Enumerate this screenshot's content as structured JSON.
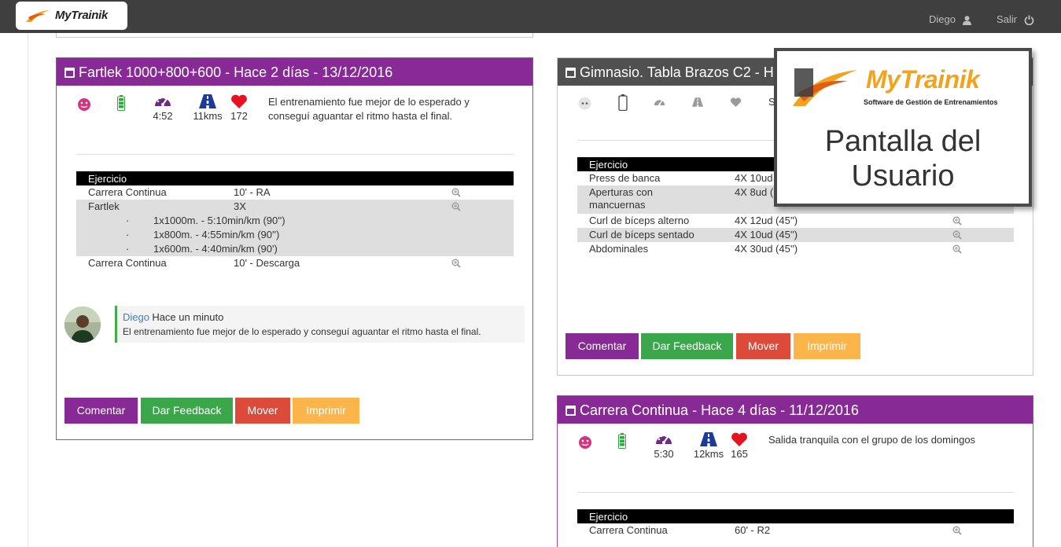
{
  "app": {
    "brand": "MyTrainik"
  },
  "topbar": {
    "user": "Diego",
    "logout": "Salir"
  },
  "promo": {
    "brand": "MyTrainik",
    "tagline": "Software de Gestión de Entrenamientos",
    "title_line1": "Pantalla del",
    "title_line2": "Usuario"
  },
  "colors": {
    "purple": "#872a95",
    "green": "#3aa84a",
    "red": "#dc4a3a",
    "orange": "#fbb54a",
    "header_dark": "#505050"
  },
  "cards": [
    {
      "title": "Fartlek 1000+800+600 - Hace 2 días - 13/12/2016",
      "stats": {
        "pace": "4:52",
        "distance": "11kms",
        "heart": "172"
      },
      "note": "El entrenamiento fue mejor de lo esperado y conseguí aguantar el ritmo hasta el final.",
      "table_header": "Ejercicio",
      "rows": [
        {
          "name": "Carrera Continua",
          "detail": "10' - RA"
        },
        {
          "name": "Fartlek",
          "detail": "3X"
        },
        {
          "name": "Carrera Continua",
          "detail": "10' - Descarga"
        }
      ],
      "subrows": [
        {
          "dot": "·",
          "text": "1x1000m. - 5:10min/km (90'')"
        },
        {
          "dot": "·",
          "text": "1x800m. - 4:55min/km (90'')"
        },
        {
          "dot": "·",
          "text": "1x600m. - 4:40min/km (90')"
        }
      ],
      "comment": {
        "author": "Diego",
        "when": "Hace un minuto",
        "text": "El entrenamiento fue mejor de lo esperado y conseguí aguantar el ritmo hasta el final."
      },
      "buttons": {
        "comment": "Comentar",
        "feedback": "Dar Feedback",
        "move": "Mover",
        "print": "Imprimir"
      }
    },
    {
      "title": "Gimnasio. Tabla Brazos C2 - H",
      "note_start": "S",
      "table_header": "Ejercicio",
      "rows": [
        {
          "name": "Press de banca",
          "detail": "4X 10ud"
        },
        {
          "name": "Aperturas con mancuernas",
          "detail": "4X 8ud ("
        },
        {
          "name": "Curl de bíceps alterno",
          "detail": "4X 12ud (45'')"
        },
        {
          "name": "Curl de bíceps sentado",
          "detail": "4X 10ud (45'')"
        },
        {
          "name": "Abdominales",
          "detail": "4X 30ud (45'')"
        }
      ],
      "buttons": {
        "comment": "Comentar",
        "feedback": "Dar Feedback",
        "move": "Mover",
        "print": "Imprimir"
      }
    },
    {
      "title": "Carrera Continua - Hace 4 días - 11/12/2016",
      "stats": {
        "pace": "5:30",
        "distance": "12kms",
        "heart": "165"
      },
      "note": "Salida tranquila con el grupo de los domingos",
      "table_header": "Ejercicio",
      "rows": [
        {
          "name": "Carrera Continua",
          "detail": "60' - R2"
        }
      ]
    }
  ]
}
